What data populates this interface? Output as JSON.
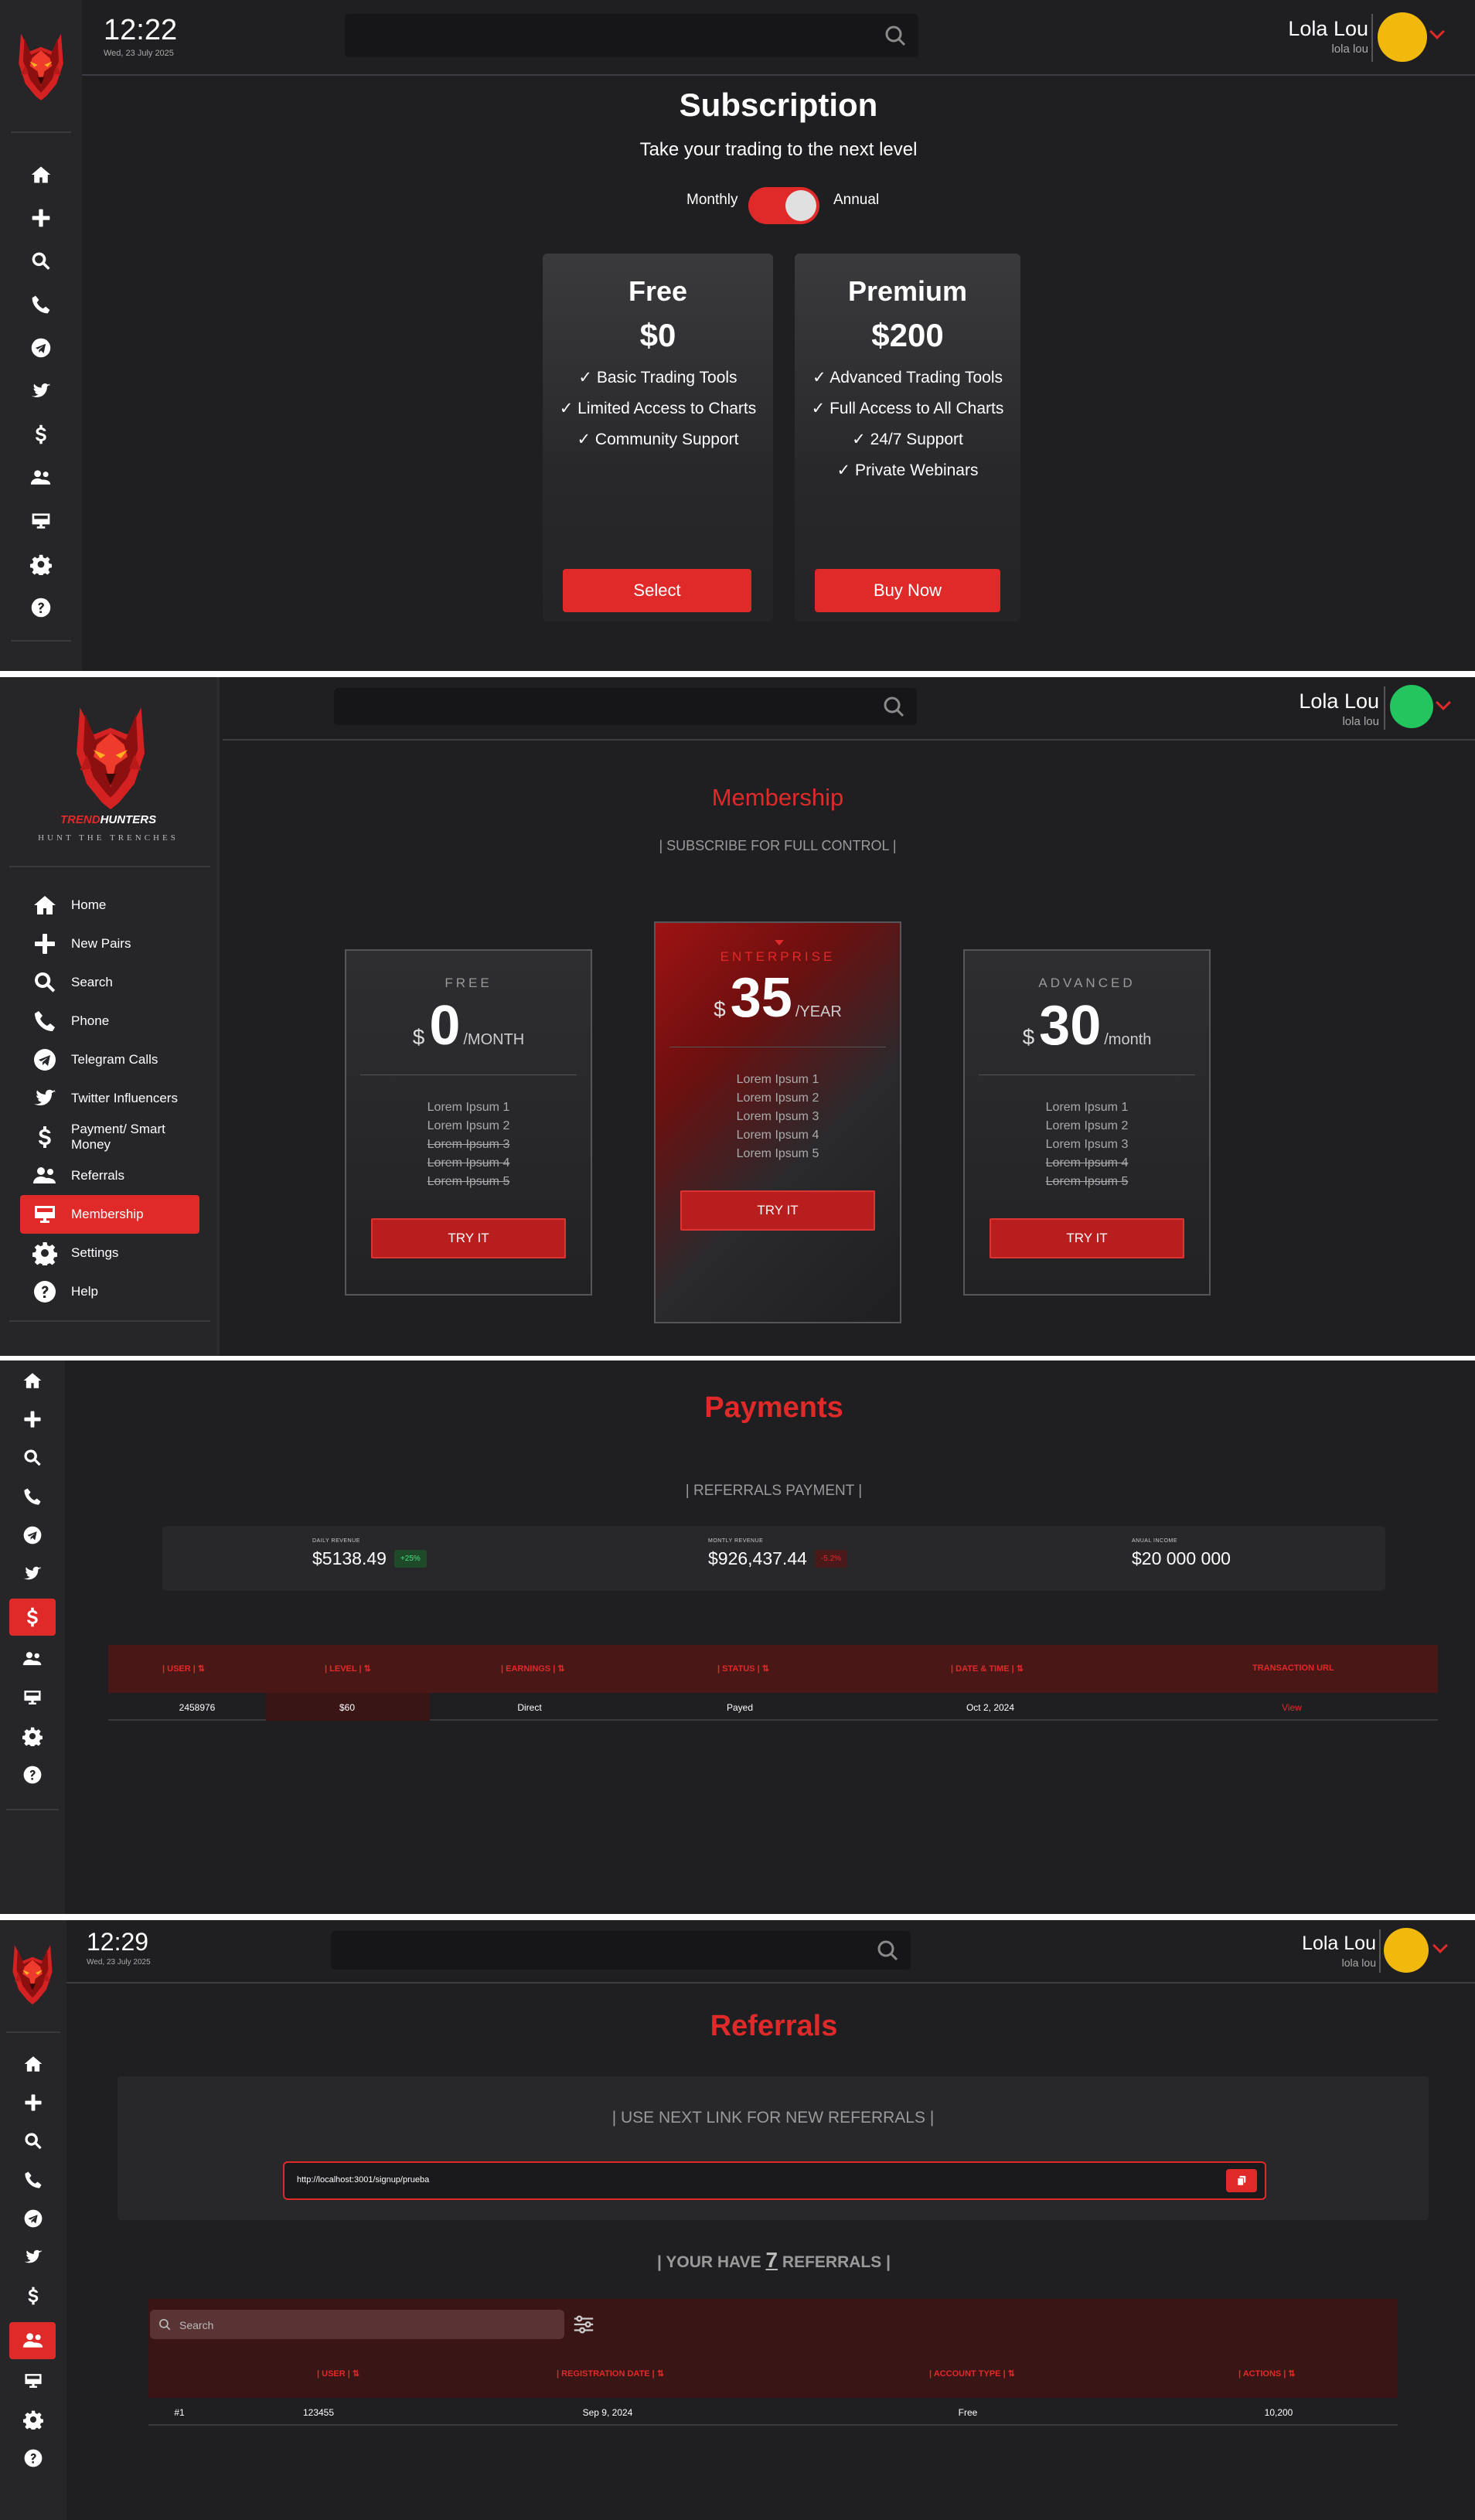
{
  "colors": {
    "accent": "#e02a2a",
    "background": "#1f1f21",
    "sidebar": "#262629",
    "avatar_yellow": "#f0b90b",
    "avatar_green": "#22c55e"
  },
  "user": {
    "name": "Lola Lou",
    "username": "lola lou"
  },
  "clock1": {
    "time": "12:22",
    "date": "Wed, 23 July 2025"
  },
  "clock4": {
    "time": "12:29",
    "date": "Wed, 23 July 2025"
  },
  "rail_icons": [
    "home-icon",
    "plus-icon",
    "search-icon",
    "phone-icon",
    "telegram-icon",
    "twitter-icon",
    "dollar-icon",
    "users-icon",
    "monitor-icon",
    "gear-icon",
    "help-icon"
  ],
  "subscription": {
    "title": "Subscription",
    "subtitle": "Take your trading to the next level",
    "toggle_left": "Monthly",
    "toggle_right": "Annual",
    "plans": [
      {
        "name": "Free",
        "price": "$0",
        "features": [
          "✓ Basic Trading Tools",
          "✓ Limited Access to Charts",
          "✓ Community Support"
        ],
        "button": "Select"
      },
      {
        "name": "Premium",
        "price": "$200",
        "features": [
          "✓ Advanced Trading Tools",
          "✓ Full Access to All Charts",
          "✓ 24/7 Support",
          "✓ Private Webinars"
        ],
        "button": "Buy Now"
      }
    ]
  },
  "brand": {
    "name_red": "TREND",
    "name_white": "HUNTERS",
    "tagline": "HUNT THE TRENCHES"
  },
  "nav": [
    {
      "label": "Home",
      "icon": "home-icon"
    },
    {
      "label": "New Pairs",
      "icon": "plus-icon"
    },
    {
      "label": "Search",
      "icon": "search-icon"
    },
    {
      "label": "Phone",
      "icon": "phone-icon"
    },
    {
      "label": "Telegram Calls",
      "icon": "telegram-icon"
    },
    {
      "label": "Twitter Influencers",
      "icon": "twitter-icon"
    },
    {
      "label": "Payment/ Smart Money",
      "icon": "dollar-icon"
    },
    {
      "label": "Referrals",
      "icon": "users-icon"
    },
    {
      "label": "Membership",
      "icon": "monitor-icon"
    },
    {
      "label": "Settings",
      "icon": "gear-icon"
    },
    {
      "label": "Help",
      "icon": "help-icon"
    }
  ],
  "membership": {
    "title": "Membership",
    "subtitle": "| SUBSCRIBE FOR FULL CONTROL |",
    "plans": [
      {
        "tier": "FREE",
        "currency": "$",
        "amount": "0",
        "period": "/MONTH",
        "items": [
          "Lorem Ipsum 1",
          "Lorem Ipsum 2",
          "Lorem Ipsum 3",
          "Lorem Ipsum 4",
          "Lorem Ipsum 5"
        ],
        "button": "TRY IT"
      },
      {
        "tier": "ENTERPRISE",
        "currency": "$",
        "amount": "35",
        "period": "/YEAR",
        "items": [
          "Lorem Ipsum 1",
          "Lorem Ipsum 2",
          "Lorem Ipsum 3",
          "Lorem Ipsum 4",
          "Lorem Ipsum 5"
        ],
        "button": "TRY IT"
      },
      {
        "tier": "ADVANCED",
        "currency": "$",
        "amount": "30",
        "period": "/month",
        "items": [
          "Lorem Ipsum 1",
          "Lorem Ipsum 2",
          "Lorem Ipsum 3",
          "Lorem Ipsum 4",
          "Lorem Ipsum 5"
        ],
        "button": "TRY IT"
      }
    ]
  },
  "payments": {
    "title": "Payments",
    "subtitle": "| REFERRALS PAYMENT |",
    "stats": [
      {
        "label": "DAILY REVENUE",
        "value": "$5138.49",
        "badge": "+25%"
      },
      {
        "label": "MONTLY REVENUE",
        "value": "$926,437.44",
        "badge": "-5.2%"
      },
      {
        "label": "ANUAL INCOME",
        "value": "$20 000 000"
      }
    ],
    "columns": [
      "USER",
      "LEVEL",
      "EARNINGS",
      "STATUS",
      "DATE & TIME",
      "TRANSACTION URL"
    ],
    "rows": [
      [
        "2458976",
        "$60",
        "Direct",
        "Payed",
        "Oct 2, 2024",
        "View"
      ]
    ]
  },
  "referrals": {
    "title": "Referrals",
    "link_label": "| USE NEXT LINK FOR NEW REFERRALS |",
    "link": "http://localhost:3001/signup/prueba",
    "count_prefix": "| YOUR HAVE",
    "count": "7",
    "count_suffix": "REFERRALS |",
    "search_placeholder": "Search",
    "columns": [
      "USER",
      "REGISTRATION DATE",
      "ACCOUNT TYPE",
      "ACTIONS"
    ],
    "rows": [
      [
        "#1",
        "123455",
        "Sep 9, 2024",
        "Free",
        "10,200"
      ]
    ]
  }
}
